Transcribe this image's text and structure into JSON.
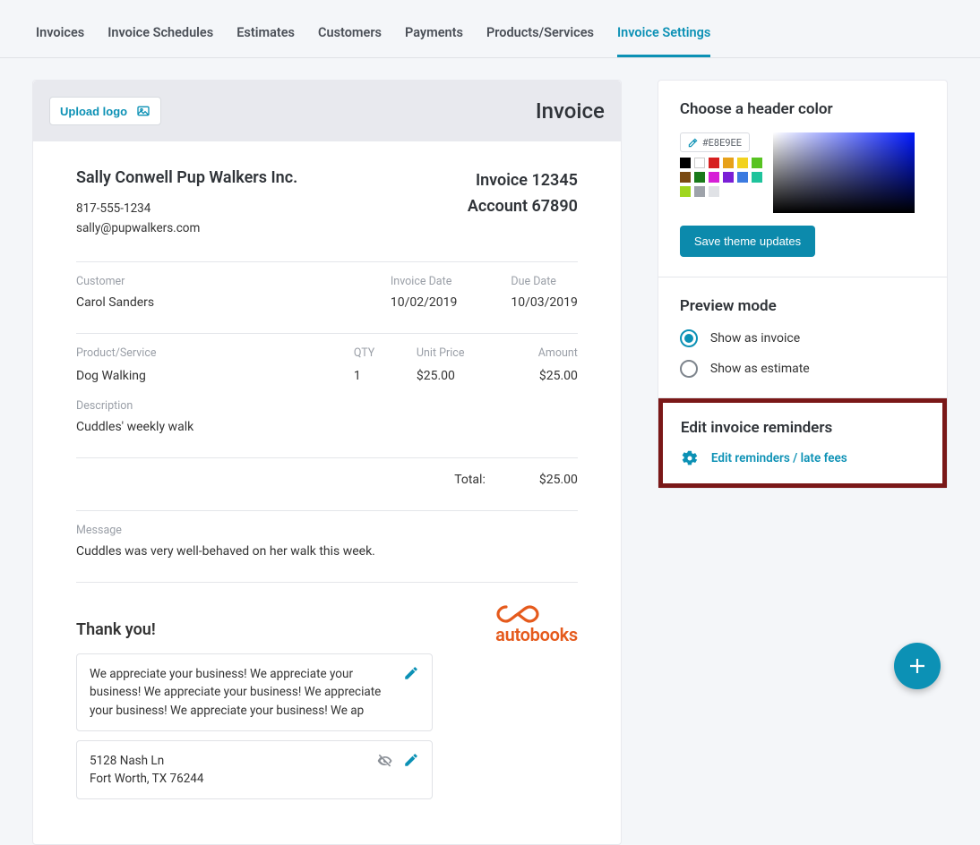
{
  "tabs": {
    "items": [
      "Invoices",
      "Invoice Schedules",
      "Estimates",
      "Customers",
      "Payments",
      "Products/Services",
      "Invoice Settings"
    ],
    "active_index": 6
  },
  "invoice": {
    "upload_logo_label": "Upload logo",
    "title": "Invoice",
    "business_name": "Sally Conwell Pup Walkers Inc.",
    "phone": "817-555-1234",
    "email": "sally@pupwalkers.com",
    "invoice_id_label": "Invoice 12345",
    "account_id_label": "Account 67890",
    "customer_label": "Customer",
    "customer_name": "Carol Sanders",
    "invoice_date_label": "Invoice Date",
    "invoice_date": "10/02/2019",
    "due_date_label": "Due Date",
    "due_date": "10/03/2019",
    "col_product": "Product/Service",
    "col_qty": "QTY",
    "col_unit": "Unit Price",
    "col_amount": "Amount",
    "line": {
      "product": "Dog Walking",
      "qty": "1",
      "unit": "$25.00",
      "amount": "$25.00"
    },
    "description_label": "Description",
    "description": "Cuddles' weekly walk",
    "total_label": "Total:",
    "total": "$25.00",
    "message_label": "Message",
    "message": "Cuddles was very well-behaved on her walk this week.",
    "thankyou_heading": "Thank you!",
    "appreciate_note": "We appreciate your business! We appreciate your business! We appreciate your business! We appreciate your business! We appreciate your business! We ap",
    "address_line1": "5128 Nash Ln",
    "address_line2": "Fort Worth, TX 76244",
    "logo_text": "autobooks"
  },
  "sidebar": {
    "color_heading": "Choose a header color",
    "hex_value": "#E8E9EE",
    "swatches": [
      "#000000",
      "#ffffff",
      "#d61f1f",
      "#e7a11a",
      "#f2d21f",
      "#58c322",
      "#7a4a12",
      "#c01fc0",
      "#d61fd6",
      "#7a1fd6",
      "#1f6fd6",
      "#1fc39c",
      "#9fd61f",
      "#b3b6ba",
      "#e0e2e6"
    ],
    "save_label": "Save theme updates",
    "preview_heading": "Preview mode",
    "preview_options": [
      "Show as invoice",
      "Show as estimate"
    ],
    "preview_selected": 0,
    "reminders_heading": "Edit invoice reminders",
    "reminders_link": "Edit reminders / late fees"
  },
  "colors": {
    "accent": "#0c91b5",
    "highlight_border": "#7a1818",
    "autobooks": "#e55a1c"
  }
}
